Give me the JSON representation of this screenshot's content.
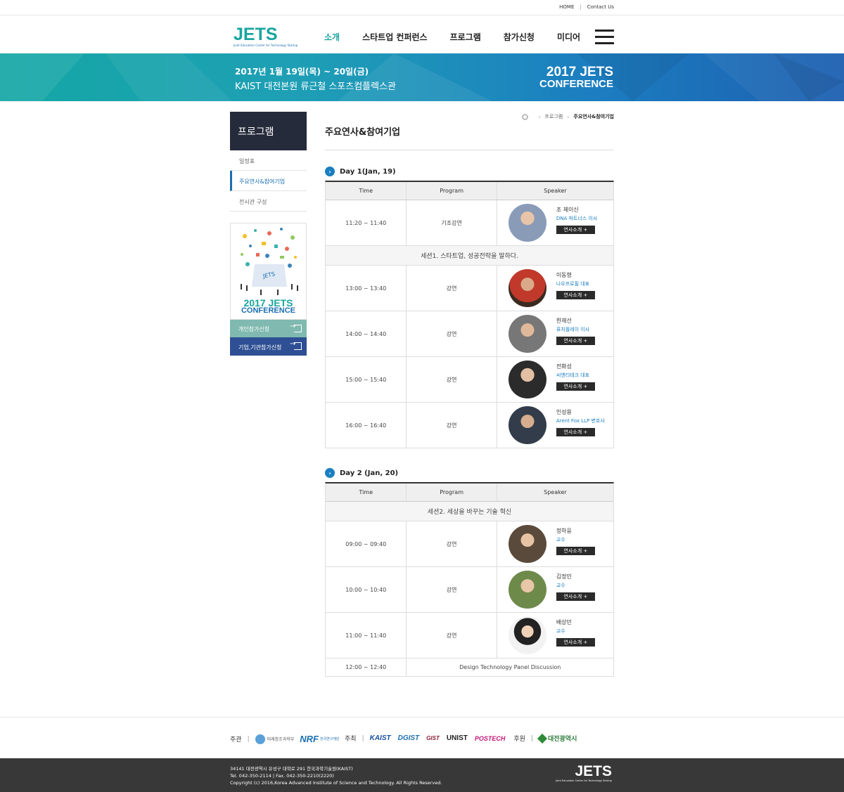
{
  "util": {
    "home": "HOME",
    "contact": "Contact Us"
  },
  "logo": {
    "title": "JETS",
    "subtitle": "Joint Education Center for Technology Startup"
  },
  "nav": [
    {
      "label": "소개",
      "active": true
    },
    {
      "label": "스타트업 컨퍼런스",
      "active": false
    },
    {
      "label": "프로그램",
      "active": false
    },
    {
      "label": "참가신청",
      "active": false
    },
    {
      "label": "미디어",
      "active": false
    }
  ],
  "banner": {
    "date": "2017년 1월 19일(목) ~ 20일(금)",
    "place": "KAIST 대전본원 류근철 스포츠컴플렉스관",
    "conf_year": "2017 JETS",
    "conf_word": "CONFERENCE"
  },
  "sidebar": {
    "title": "프로그램",
    "items": [
      {
        "label": "일정표",
        "active": false
      },
      {
        "label": "주요연사&참여기업",
        "active": true
      },
      {
        "label": "전시관 구성",
        "active": false
      }
    ],
    "poster_year": "2017 JETS",
    "poster_word": "CONFERENCE",
    "btn_personal": "개인참가신청",
    "btn_company": "기업,기관참가신청"
  },
  "breadcrumb": {
    "parent": "프로그램",
    "current": "주요연사&참여기업"
  },
  "page_title": "주요연사&참여기업",
  "table_headers": {
    "time": "Time",
    "program": "Program",
    "speaker": "Speaker"
  },
  "speaker_button": "연사소개 +",
  "day1": {
    "title": "Day 1(Jan, 19)",
    "keynote": {
      "time": "11:20 ~ 11:40",
      "program": "기조강연",
      "name": "조 제이신",
      "role": "DNA 파트너스 이사"
    },
    "session": "세션1. 스타트업, 성공전략을 말하다.",
    "rows": [
      {
        "time": "13:00 ~ 13:40",
        "program": "강연",
        "name": "이동형",
        "role": "나우프로필 대표"
      },
      {
        "time": "14:00 ~ 14:40",
        "program": "강연",
        "name": "한재선",
        "role": "퓨처플레이 이사"
      },
      {
        "time": "15:00 ~ 15:40",
        "program": "강연",
        "name": "전화성",
        "role": "씨엔티테크 대표"
      },
      {
        "time": "16:00 ~ 16:40",
        "program": "강연",
        "name": "인성용",
        "role": "Arent Fox LLP 변호사"
      }
    ]
  },
  "day2": {
    "title": "Day 2 (Jan, 20)",
    "session": "세션2. 세상을 바꾸는 기술 혁신",
    "rows": [
      {
        "time": "09:00 ~ 09:40",
        "program": "강연",
        "name": "정하웅",
        "role": "교수"
      },
      {
        "time": "10:00 ~ 10:40",
        "program": "강연",
        "name": "김정인",
        "role": "교수"
      },
      {
        "time": "11:00 ~ 11:40",
        "program": "강연",
        "name": "배상민",
        "role": "교수"
      }
    ],
    "panel": {
      "time": "12:00 ~ 12:40",
      "program": "Design Technology Panel Discussion"
    }
  },
  "sponsors": {
    "host_label": "주관",
    "organizer_label": "주최",
    "support_label": "후원",
    "host_logos": [
      "미래창조과학부",
      "NRF",
      "한국연구재단"
    ],
    "organizer_logos": [
      "KAIST",
      "DGIST",
      "GIST",
      "UNIST",
      "POSTECH"
    ],
    "support_logos": [
      "대전광역시"
    ]
  },
  "footer": {
    "line1": "34141 대전광역시 유성구 대학로 291 한국과학기술원(KAIST)",
    "line2": "Tel. 042-350-2114  |  Fax. 042-350-2210(2220)",
    "line3": "Copyright (c) 2016,Korea Advanced Institute of Science and Technology. All Rights Reserved.",
    "logo": "JETS",
    "logo_sub": "Joint Education Center for Technology Startup"
  },
  "colors": {
    "accent": "#1aa5a0",
    "brand_blue": "#1a6fb0",
    "dark_navy": "#262b3b",
    "footer": "#383838"
  }
}
